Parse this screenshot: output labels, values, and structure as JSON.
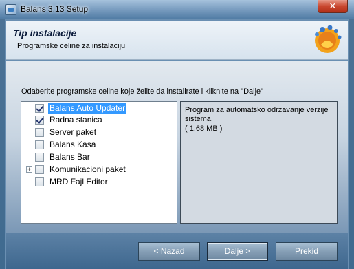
{
  "window": {
    "title": "Balans 3.13 Setup",
    "close_icon": "close-icon"
  },
  "header": {
    "title": "Tip instalacije",
    "subtitle": "Programske celine za instalaciju"
  },
  "instruction": "Odaberite programske celine koje želite da instalirate i kliknite na \"Dalje\"",
  "components": [
    {
      "label": "Balans Auto Updater",
      "checked": true,
      "selected": true,
      "expandable": false
    },
    {
      "label": "Radna stanica",
      "checked": true,
      "selected": false,
      "expandable": false
    },
    {
      "label": "Server paket",
      "checked": false,
      "selected": false,
      "expandable": false
    },
    {
      "label": "Balans Kasa",
      "checked": false,
      "selected": false,
      "expandable": false
    },
    {
      "label": "Balans Bar",
      "checked": false,
      "selected": false,
      "expandable": false
    },
    {
      "label": "Komunikacioni paket",
      "checked": false,
      "selected": false,
      "expandable": true
    },
    {
      "label": "MRD Fajl Editor",
      "checked": false,
      "selected": false,
      "expandable": false
    }
  ],
  "description": {
    "text": "Program za automatsko odrzavanje verzije sistema.",
    "size": "( 1.68 MB )"
  },
  "buttons": {
    "back": {
      "prefix": "< ",
      "accel": "N",
      "rest": "azad"
    },
    "next": {
      "accel": "D",
      "rest": "alje >"
    },
    "cancel": {
      "accel": "P",
      "rest": "rekid"
    }
  },
  "colors": {
    "selection": "#3399ff",
    "close_button": "#c9472f"
  }
}
